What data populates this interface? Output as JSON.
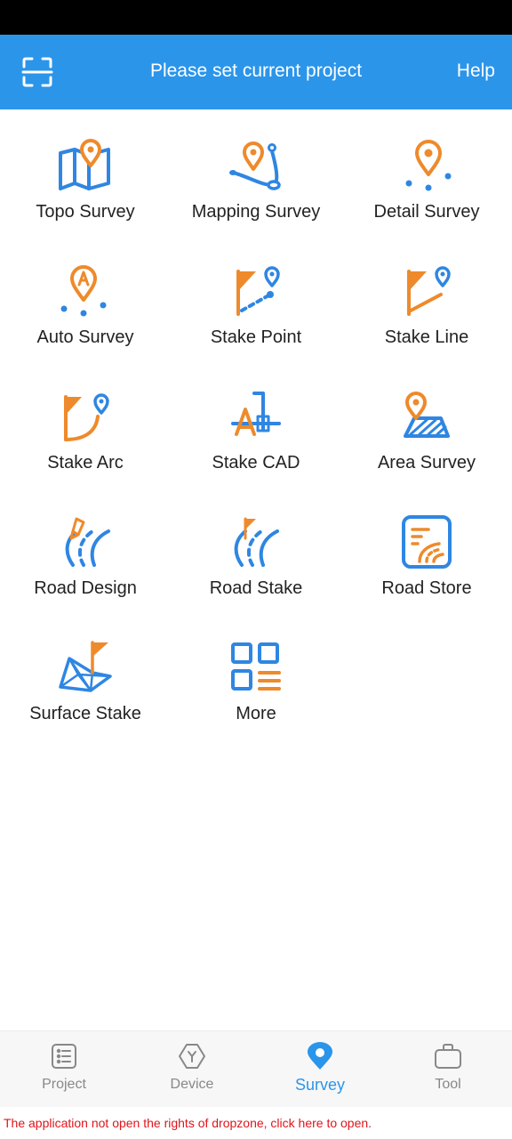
{
  "header": {
    "title": "Please set current project",
    "help_label": "Help",
    "scan_icon": "scan-frame-icon"
  },
  "colors": {
    "header_bg": "#2b95ea",
    "icon_blue": "#2f86e2",
    "icon_orange": "#ee8a2b",
    "active_tab": "#2b95ea",
    "inactive_tab": "#888888",
    "notice_text": "#e0151b"
  },
  "grid": {
    "items": [
      {
        "label": "Topo Survey",
        "icon": "topo-survey-icon"
      },
      {
        "label": "Mapping Survey",
        "icon": "mapping-survey-icon"
      },
      {
        "label": "Detail Survey",
        "icon": "detail-survey-icon"
      },
      {
        "label": "Auto Survey",
        "icon": "auto-survey-icon"
      },
      {
        "label": "Stake Point",
        "icon": "stake-point-icon"
      },
      {
        "label": "Stake Line",
        "icon": "stake-line-icon"
      },
      {
        "label": "Stake Arc",
        "icon": "stake-arc-icon"
      },
      {
        "label": "Stake CAD",
        "icon": "stake-cad-icon"
      },
      {
        "label": "Area Survey",
        "icon": "area-survey-icon"
      },
      {
        "label": "Road Design",
        "icon": "road-design-icon"
      },
      {
        "label": "Road Stake",
        "icon": "road-stake-icon"
      },
      {
        "label": "Road Store",
        "icon": "road-store-icon"
      },
      {
        "label": "Surface Stake",
        "icon": "surface-stake-icon"
      },
      {
        "label": "More",
        "icon": "more-grid-icon"
      }
    ]
  },
  "bottom_nav": {
    "items": [
      {
        "label": "Project",
        "icon": "list-icon",
        "active": false
      },
      {
        "label": "Device",
        "icon": "device-icon",
        "active": false
      },
      {
        "label": "Survey",
        "icon": "location-pin-icon",
        "active": true
      },
      {
        "label": "Tool",
        "icon": "toolbox-icon",
        "active": false
      }
    ]
  },
  "notice": {
    "text": "The application not open the rights of dropzone, click here to open."
  }
}
